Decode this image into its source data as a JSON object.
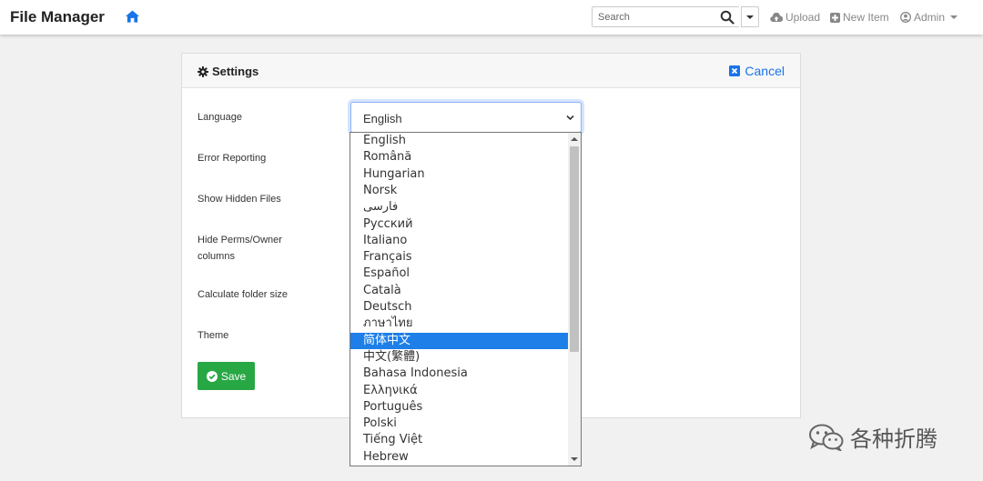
{
  "navbar": {
    "brand": "File Manager",
    "search_placeholder": "Search",
    "upload_label": "Upload",
    "new_item_label": "New Item",
    "admin_label": "Admin"
  },
  "settings": {
    "title": "Settings",
    "cancel_label": "Cancel",
    "labels": {
      "language": "Language",
      "error_reporting": "Error Reporting",
      "show_hidden": "Show Hidden Files",
      "hide_perms_line1": "Hide Perms/Owner",
      "hide_perms_line2": "columns",
      "calc_folder": "Calculate folder size",
      "theme": "Theme"
    },
    "language_selected": "English",
    "save_label": "Save"
  },
  "language_options": [
    "English",
    "Română",
    "Hungarian",
    "Norsk",
    "فارسی",
    "Русский",
    "Italiano",
    "Français",
    "Español",
    "Català",
    "Deutsch",
    "ภาษาไทย",
    "简体中文",
    "中文(繁體)",
    "Bahasa Indonesia",
    "Ελληνικά",
    "Português",
    "Polski",
    "Tiếng Việt",
    "Hebrew"
  ],
  "highlighted_option": "简体中文",
  "watermark": "各种折腾",
  "colors": {
    "accent": "#1a73e8",
    "highlight": "#1e7fe8",
    "save_green": "#28a745"
  },
  "icons": {
    "home": "home-icon",
    "search": "search-icon",
    "upload": "cloud-upload-icon",
    "new_item": "plus-square-icon",
    "admin": "user-circle-icon",
    "settings": "gear-icon",
    "cancel": "close-square-icon",
    "save": "check-circle-icon"
  }
}
